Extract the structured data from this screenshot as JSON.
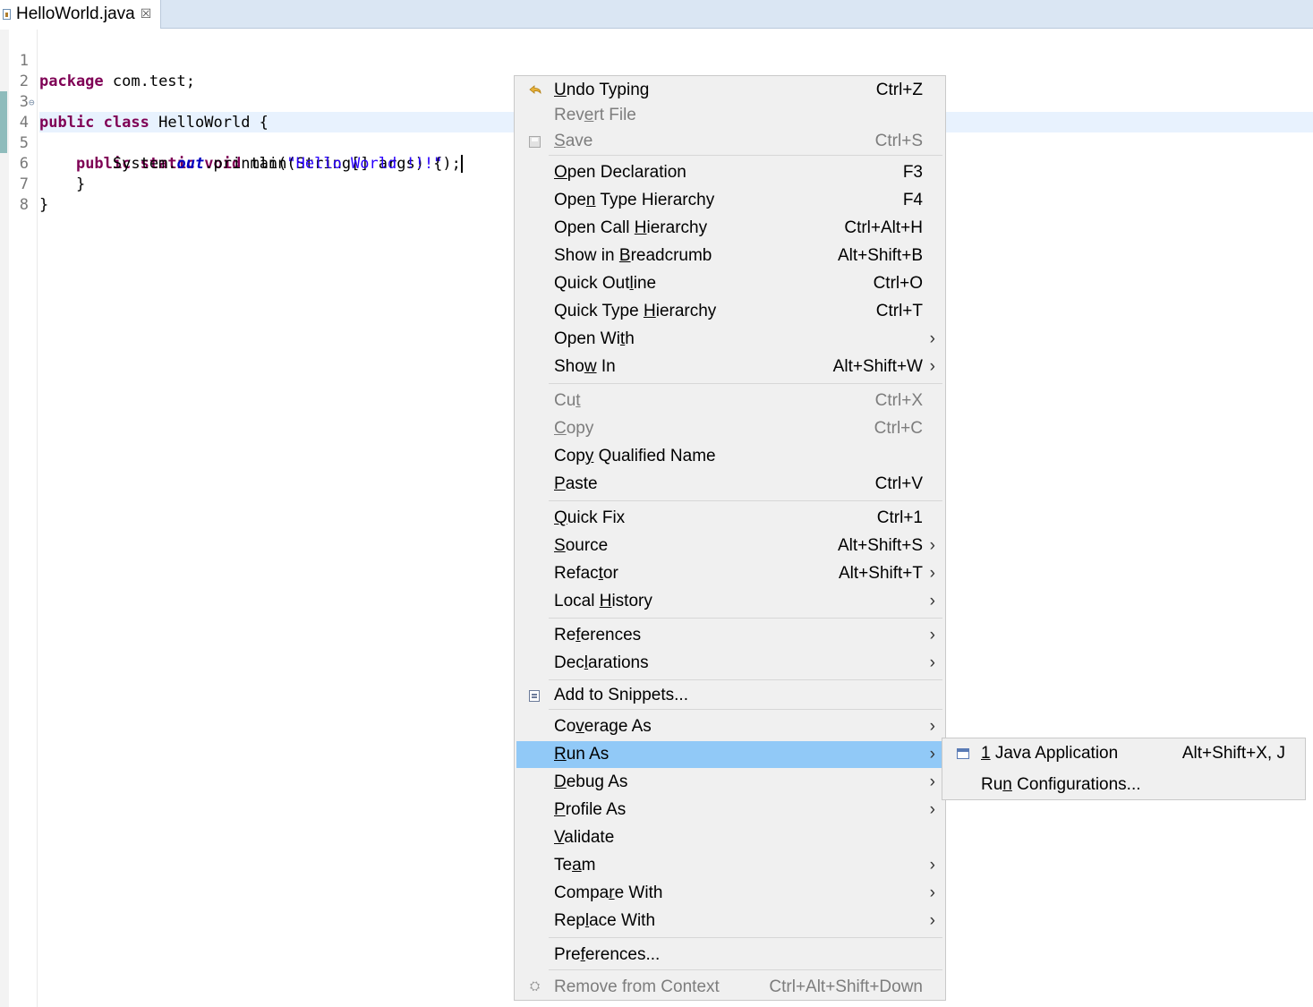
{
  "tab": {
    "title": "HelloWorld.java",
    "close_glyph": "☒"
  },
  "editor": {
    "lines": [
      {
        "num": "1",
        "kw1": "package",
        "rest": " com.test;"
      },
      {
        "num": "2"
      },
      {
        "num": "3",
        "kw1": "public",
        "kw2": "class",
        "rest": " HelloWorld {"
      },
      {
        "num": "4",
        "kw1": "public",
        "kw2": "static",
        "kw3": "void",
        "rest": " main(String[] args) {"
      },
      {
        "num": "5",
        "obj": "System.",
        "field": "out",
        "call": ".println(",
        "str": "\"Hello World !!!\"",
        "end": ");"
      },
      {
        "num": "6",
        "rest": "}"
      },
      {
        "num": "7",
        "rest": "}"
      },
      {
        "num": "8"
      }
    ],
    "fold_glyph": "⊖"
  },
  "menu": {
    "undo": {
      "label_pre": "",
      "label_u": "U",
      "label_post": "ndo Typing",
      "shortcut": "Ctrl+Z"
    },
    "revert": {
      "label_pre": "Rev",
      "label_u": "e",
      "label_post": "rt File"
    },
    "save": {
      "label_pre": "",
      "label_u": "S",
      "label_post": "ave",
      "shortcut": "Ctrl+S"
    },
    "open_declaration": {
      "label_pre": "",
      "label_u": "O",
      "label_post": "pen Declaration",
      "shortcut": "F3"
    },
    "open_type_hierarchy": {
      "label_pre": "Ope",
      "label_u": "n",
      "label_post": " Type Hierarchy",
      "shortcut": "F4"
    },
    "open_call_hierarchy": {
      "label_pre": "Open Call ",
      "label_u": "H",
      "label_post": "ierarchy",
      "shortcut": "Ctrl+Alt+H"
    },
    "show_in_breadcrumb": {
      "label_pre": "Show in ",
      "label_u": "B",
      "label_post": "readcrumb",
      "shortcut": "Alt+Shift+B"
    },
    "quick_outline": {
      "label_pre": "Quick Out",
      "label_u": "l",
      "label_post": "ine",
      "shortcut": "Ctrl+O"
    },
    "quick_type_hierarchy": {
      "label_pre": "Quick Type ",
      "label_u": "H",
      "label_post": "ierarchy",
      "shortcut": "Ctrl+T"
    },
    "open_with": {
      "label_pre": "Open Wi",
      "label_u": "t",
      "label_post": "h"
    },
    "show_in": {
      "label_pre": "Sho",
      "label_u": "w",
      "label_post": " In",
      "shortcut": "Alt+Shift+W"
    },
    "cut": {
      "label_pre": "Cu",
      "label_u": "t",
      "label_post": "",
      "shortcut": "Ctrl+X"
    },
    "copy": {
      "label_pre": "",
      "label_u": "C",
      "label_post": "opy",
      "shortcut": "Ctrl+C"
    },
    "copy_qualified_name": {
      "label_pre": "Cop",
      "label_u": "y",
      "label_post": " Qualified Name"
    },
    "paste": {
      "label_pre": "",
      "label_u": "P",
      "label_post": "aste",
      "shortcut": "Ctrl+V"
    },
    "quick_fix": {
      "label_pre": "",
      "label_u": "Q",
      "label_post": "uick Fix",
      "shortcut": "Ctrl+1"
    },
    "source": {
      "label_pre": "",
      "label_u": "S",
      "label_post": "ource",
      "shortcut": "Alt+Shift+S"
    },
    "refactor": {
      "label_pre": "Refac",
      "label_u": "t",
      "label_post": "or",
      "shortcut": "Alt+Shift+T"
    },
    "local_history": {
      "label_pre": "Local ",
      "label_u": "H",
      "label_post": "istory"
    },
    "references": {
      "label_pre": "Re",
      "label_u": "f",
      "label_post": "erences"
    },
    "declarations": {
      "label_pre": "Dec",
      "label_u": "l",
      "label_post": "arations"
    },
    "add_to_snippets": {
      "label_pre": "Add to Snippets...",
      "label_u": "",
      "label_post": ""
    },
    "coverage_as": {
      "label_pre": "Co",
      "label_u": "v",
      "label_post": "erage As"
    },
    "run_as": {
      "label_pre": "",
      "label_u": "R",
      "label_post": "un As"
    },
    "debug_as": {
      "label_pre": "",
      "label_u": "D",
      "label_post": "ebug As"
    },
    "profile_as": {
      "label_pre": "",
      "label_u": "P",
      "label_post": "rofile As"
    },
    "validate": {
      "label_pre": "",
      "label_u": "V",
      "label_post": "alidate"
    },
    "team": {
      "label_pre": "Te",
      "label_u": "a",
      "label_post": "m"
    },
    "compare_with": {
      "label_pre": "Compa",
      "label_u": "r",
      "label_post": "e With"
    },
    "replace_with": {
      "label_pre": "Rep",
      "label_u": "l",
      "label_post": "ace With"
    },
    "preferences": {
      "label_pre": "Pre",
      "label_u": "f",
      "label_post": "erences..."
    },
    "remove_from_context": {
      "label_pre": "Remove from Context",
      "label_u": "",
      "label_post": "",
      "shortcut": "Ctrl+Alt+Shift+Down"
    },
    "arrow_glyph": "›"
  },
  "submenu": {
    "java_application": {
      "label_pre": "",
      "label_u": "1",
      "label_post": " Java Application",
      "shortcut": "Alt+Shift+X, J"
    },
    "run_configurations": {
      "label_pre": "Ru",
      "label_u": "n",
      "label_post": " Configurations..."
    }
  },
  "colors": {
    "keyword": "#7f0055",
    "string": "#2a00ff",
    "field": "#0000c0",
    "menu_highlight": "#91c9f7",
    "tabbar": "#dae6f3"
  }
}
